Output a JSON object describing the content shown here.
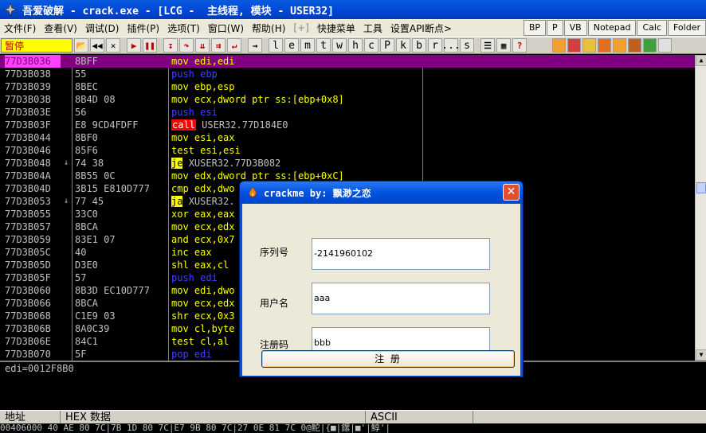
{
  "window": {
    "title": "吾爱破解 - crack.exe - [LCG -  主线程, 模块 - USER32]"
  },
  "menu": {
    "items": [
      "文件(F)",
      "查看(V)",
      "调试(D)",
      "插件(P)",
      "选项(T)",
      "窗口(W)",
      "帮助(H)",
      "[+]",
      "快捷菜单",
      "工具",
      "设置API断点>"
    ],
    "right_buttons": [
      "BP",
      "P",
      "VB",
      "Notepad",
      "Calc",
      "Folder"
    ]
  },
  "toolbar": {
    "status": "暂停",
    "letters": [
      "l",
      "e",
      "m",
      "t",
      "w",
      "h",
      "c",
      "P",
      "k",
      "b",
      "r",
      "...",
      "s"
    ]
  },
  "disasm": {
    "rows": [
      {
        "addr": "77D3B036",
        "hex": "8BFF",
        "op": "mov",
        "args": "edi,edi",
        "sel": true
      },
      {
        "addr": "77D3B038",
        "hex": "55",
        "op": "push",
        "args": "ebp"
      },
      {
        "addr": "77D3B039",
        "hex": "8BEC",
        "op": "mov",
        "args": "ebp,esp"
      },
      {
        "addr": "77D3B03B",
        "hex": "8B4D 08",
        "op": "mov",
        "args": "ecx,dword ptr ss:[ebp+0x8]"
      },
      {
        "addr": "77D3B03E",
        "hex": "56",
        "op": "push",
        "args": "esi"
      },
      {
        "addr": "77D3B03F",
        "hex": "E8 9CD4FDFF",
        "op": "call",
        "args": "USER32.77D184E0"
      },
      {
        "addr": "77D3B044",
        "hex": "8BF0",
        "op": "mov",
        "args": "esi,eax"
      },
      {
        "addr": "77D3B046",
        "hex": "85F6",
        "op": "test",
        "args": "esi,esi"
      },
      {
        "addr": "77D3B048",
        "hex": "74 38",
        "op": "je",
        "args": "XUSER32.77D3B082",
        "arrow": "v"
      },
      {
        "addr": "77D3B04A",
        "hex": "8B55 0C",
        "op": "mov",
        "args": "edx,dword ptr ss:[ebp+0xC]"
      },
      {
        "addr": "77D3B04D",
        "hex": "3B15 E810D777",
        "op": "cmp",
        "args": "edx,dwo"
      },
      {
        "addr": "77D3B053",
        "hex": "77 45",
        "op": "ja",
        "args": "XUSER32.",
        "arrow": "v"
      },
      {
        "addr": "77D3B055",
        "hex": "33C0",
        "op": "xor",
        "args": "eax,eax"
      },
      {
        "addr": "77D3B057",
        "hex": "8BCA",
        "op": "mov",
        "args": "ecx,edx"
      },
      {
        "addr": "77D3B059",
        "hex": "83E1 07",
        "op": "and",
        "args": "ecx,0x7"
      },
      {
        "addr": "77D3B05C",
        "hex": "40",
        "op": "inc",
        "args": "eax"
      },
      {
        "addr": "77D3B05D",
        "hex": "D3E0",
        "op": "shl",
        "args": "eax,cl"
      },
      {
        "addr": "77D3B05F",
        "hex": "57",
        "op": "push",
        "args": "edi"
      },
      {
        "addr": "77D3B060",
        "hex": "8B3D EC10D777",
        "op": "mov",
        "args": "edi,dwo"
      },
      {
        "addr": "77D3B066",
        "hex": "8BCA",
        "op": "mov",
        "args": "ecx,edx"
      },
      {
        "addr": "77D3B068",
        "hex": "C1E9 03",
        "op": "shr",
        "args": "ecx,0x3"
      },
      {
        "addr": "77D3B06B",
        "hex": "8A0C39",
        "op": "mov",
        "args": "cl,byte"
      },
      {
        "addr": "77D3B06E",
        "hex": "84C1",
        "op": "test",
        "args": "cl,al"
      },
      {
        "addr": "77D3B070",
        "hex": "5F",
        "op": "pop",
        "args": "edi"
      }
    ]
  },
  "info": {
    "line": "edi=0012F8B0"
  },
  "dump": {
    "headers": [
      "地址",
      "HEX 数据",
      "ASCII"
    ],
    "row": "00406000 40 AE 80 7C|7B 1D 80 7C|E7 9B 80 7C|27 0E 81 7C 0@鮀|{■|鏍|■'|鯙'|"
  },
  "dialog": {
    "title": "crackme by: 飘渺之恋",
    "fields": [
      {
        "label": "序列号",
        "value": "-2141960102"
      },
      {
        "label": "用户名",
        "value": "aaa"
      },
      {
        "label": "注册码",
        "value": "bbb"
      }
    ],
    "button": "注    册"
  }
}
